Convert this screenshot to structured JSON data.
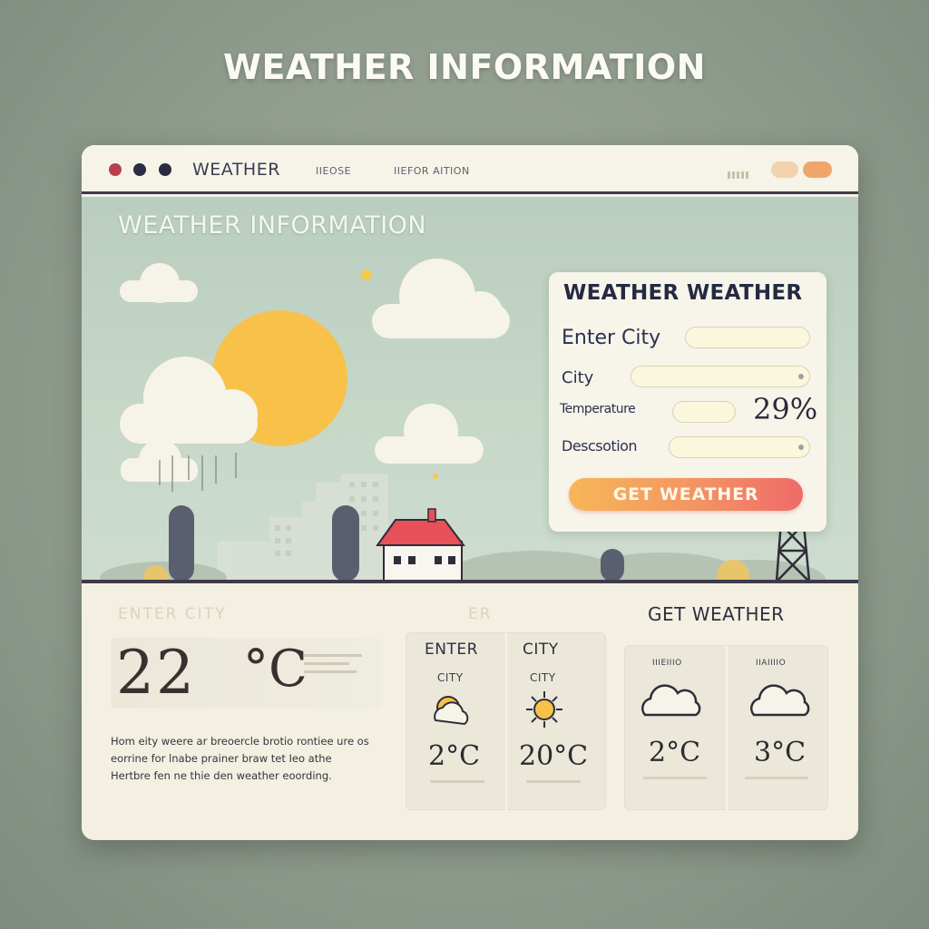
{
  "page": {
    "heading": "WEATHER INFORMATION"
  },
  "titlebar": {
    "app_name": "WEATHER",
    "nav": [
      "IIEOSE",
      "IIEFOR  AITION"
    ]
  },
  "hero": {
    "title": "WEATHER INFORMATION"
  },
  "form": {
    "title": "WEATHER WEATHER",
    "enter_city_label": "Enter City",
    "city_label": "City",
    "temperature_label": "Temperature",
    "description_label": "Descsotion",
    "temperature_value": "29%",
    "button_label": "GET WEATHER"
  },
  "current": {
    "ghost_left": "ENTER CITY",
    "ghost_right": "ER",
    "temp_number": "22",
    "temp_unit": "°C",
    "description": "Hom eity weere ar breoercle brotio rontiee ure os eorrine for lnabe prainer braw tet Ieo athe Hertbre fen ne thie den weather eoording."
  },
  "forecast": {
    "group1": [
      {
        "heading": "ENTER",
        "sub": "CITY",
        "icon": "partly-cloudy-icon",
        "temp": "2°C"
      },
      {
        "heading": "CITY",
        "sub": "CITY",
        "icon": "sun-icon",
        "temp": "20°C"
      }
    ],
    "group2_heading": "GET  WEATHER",
    "group2": [
      {
        "sub": "IIIEIIIO",
        "icon": "cloud-icon",
        "temp": "2°C"
      },
      {
        "sub": "IIAIIIIO",
        "icon": "cloud-icon",
        "temp": "3°C"
      }
    ]
  },
  "colors": {
    "accent_orange": "#f39463",
    "sun": "#f7c04a",
    "roof": "#e8505a",
    "ink": "#2b3050"
  }
}
